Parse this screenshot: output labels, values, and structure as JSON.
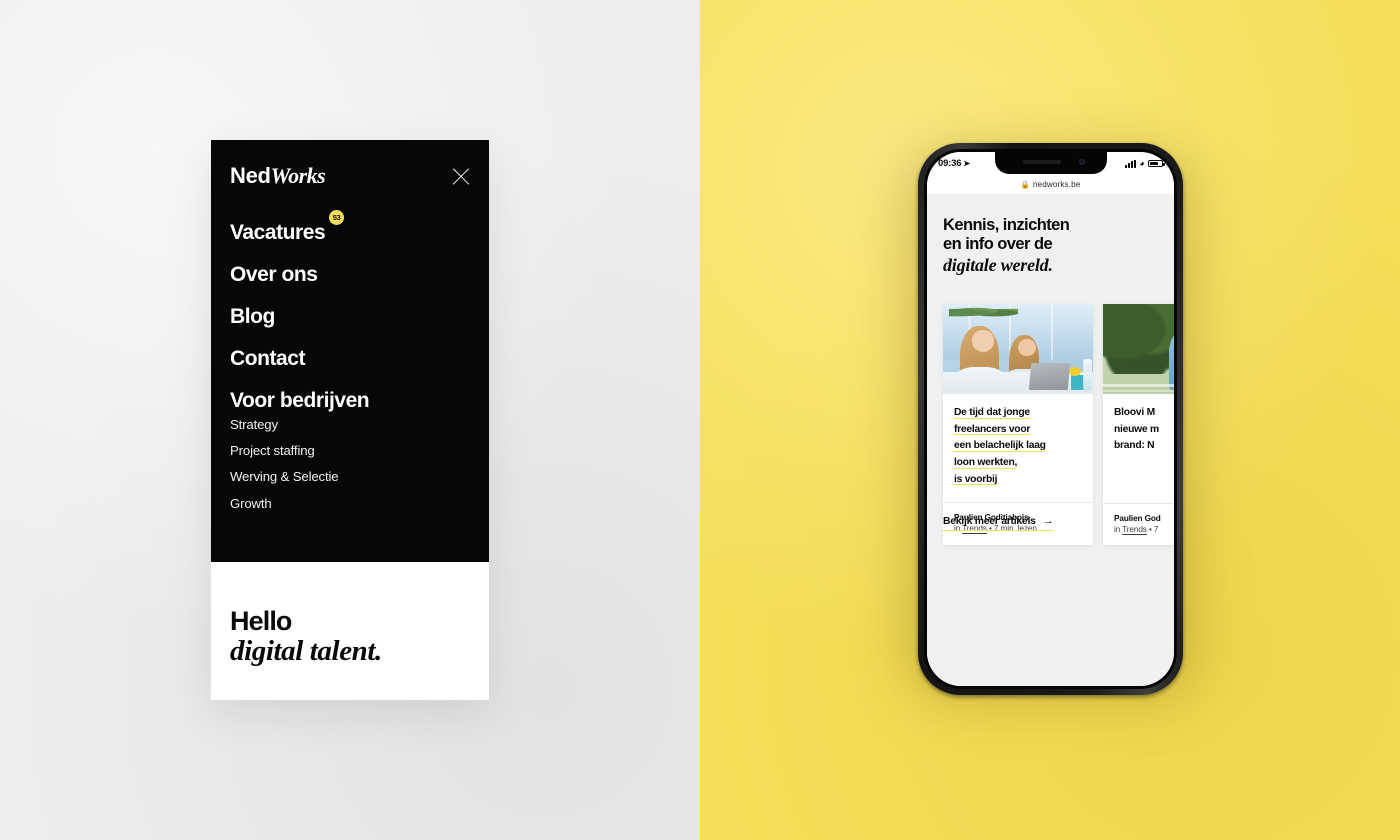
{
  "background": {
    "left_color": "#ecedec",
    "right_color": "#f6de58"
  },
  "menu_mockup": {
    "brand": {
      "part1": "Ned",
      "part2": "Works"
    },
    "close_icon_label": "close-icon",
    "nav_items": [
      {
        "label": "Vacatures",
        "badge": "53"
      },
      {
        "label": "Over ons",
        "badge": ""
      },
      {
        "label": "Blog",
        "badge": ""
      },
      {
        "label": "Contact",
        "badge": ""
      },
      {
        "label": "Voor bedrijven",
        "badge": ""
      }
    ],
    "sub_items": [
      {
        "label": "Strategy"
      },
      {
        "label": "Project staffing"
      },
      {
        "label": "Werving & Selectie"
      },
      {
        "label": "Growth"
      }
    ],
    "hero": {
      "line1": "Hello",
      "line2": "digital talent."
    }
  },
  "phone": {
    "status_bar": {
      "time": "09:36",
      "location_icon": "➤",
      "signal_icon": "signal-bars-icon",
      "wifi_icon": "📶",
      "battery_icon": "battery-icon"
    },
    "browser": {
      "lock_icon": "🔒",
      "host": "nedworks.be"
    },
    "page": {
      "headline_line1": "Kennis, inzichten",
      "headline_line2": "en info over de",
      "headline_line3": "digitale wereld.",
      "cards": [
        {
          "image_alt": "two women at office desk with laptop",
          "title_lines": [
            "De tijd dat jonge",
            "freelancers voor",
            "een belachelijk laag",
            "loon werkten,",
            "is voorbij"
          ],
          "author": "Paulien Goditiabois",
          "meta_prefix": "in ",
          "meta_source": "Trends",
          "meta_suffix": " • 7 min. lezen"
        },
        {
          "image_alt": "woman in blue dress outdoors with trees",
          "title_lines": [
            "Bloovi M",
            "nieuwe m",
            "brand: N"
          ],
          "author": "Paulien God",
          "meta_prefix": "in ",
          "meta_source": "Trends",
          "meta_suffix": " • 7"
        }
      ],
      "more_link": {
        "label": "Bekijk meer artikels",
        "arrow": "→"
      }
    }
  }
}
